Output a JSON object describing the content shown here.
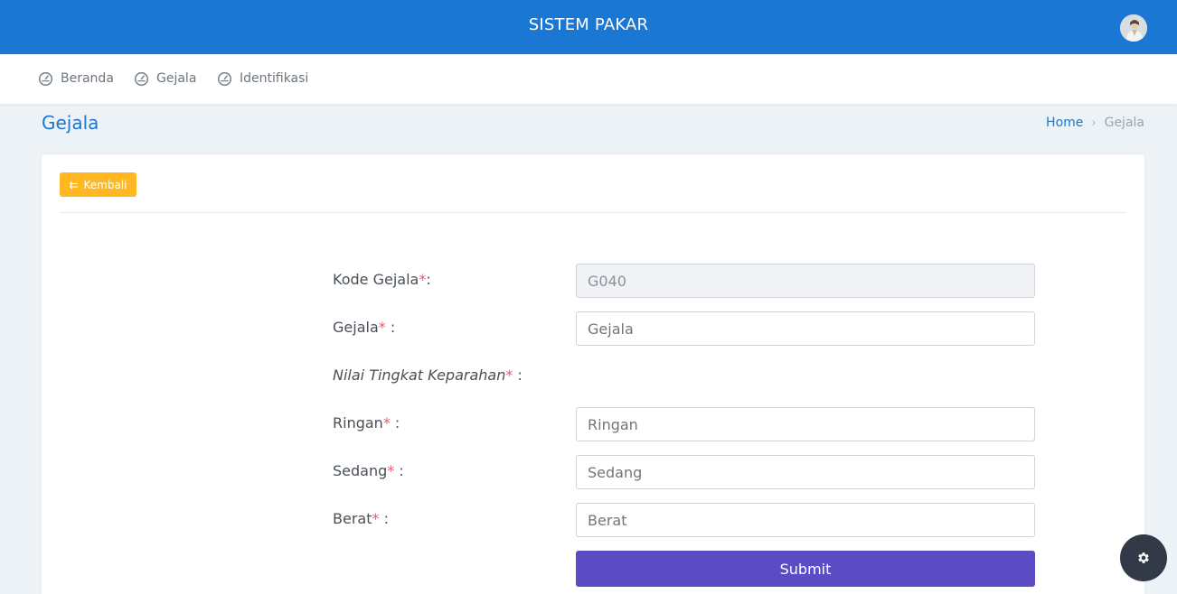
{
  "header": {
    "app_title": "SISTEM PAKAR",
    "avatar_icon": "user-avatar"
  },
  "nav": {
    "items": [
      {
        "label": "Beranda",
        "icon": "dashboard-gauge-icon"
      },
      {
        "label": "Gejala",
        "icon": "dashboard-gauge-icon"
      },
      {
        "label": "Identifikasi",
        "icon": "dashboard-gauge-icon"
      }
    ]
  },
  "page": {
    "title": "Gejala",
    "breadcrumb": {
      "home": "Home",
      "separator": "›",
      "current": "Gejala"
    }
  },
  "card": {
    "back_button": {
      "label": "Kembali",
      "icon": "back-arrow-icon",
      "color": "#ffb822"
    }
  },
  "form": {
    "required_mark": "*",
    "kode": {
      "label": "Kode Gejala",
      "suffix": ":",
      "value": "G040"
    },
    "gejala": {
      "label": "Gejala",
      "suffix": " :",
      "placeholder": "Gejala"
    },
    "nilai_heading": {
      "label": "Nilai Tingkat Keparahan",
      "suffix": " :"
    },
    "ringan": {
      "label": "Ringan",
      "suffix": " :",
      "placeholder": "Ringan"
    },
    "sedang": {
      "label": "Sedang",
      "suffix": " :",
      "placeholder": "Sedang"
    },
    "berat": {
      "label": "Berat",
      "suffix": " :",
      "placeholder": "Berat"
    },
    "submit_label": "Submit"
  },
  "colors": {
    "primary": "#1a77d4",
    "warning": "#ffb822",
    "submit": "#5b4bc4",
    "required": "#f1556c",
    "fab": "#313a46"
  },
  "fab": {
    "icon": "gear-icon"
  }
}
